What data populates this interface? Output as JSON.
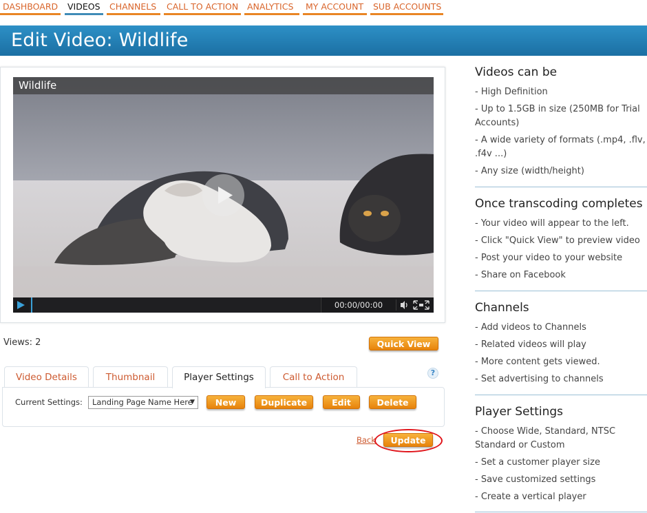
{
  "nav": {
    "items": [
      {
        "label": "DASHBOARD"
      },
      {
        "label": "VIDEOS"
      },
      {
        "label": "CHANNELS"
      },
      {
        "label": "CALL TO ACTION"
      },
      {
        "label": "ANALYTICS"
      },
      {
        "label": "MY ACCOUNT"
      },
      {
        "label": "SUB ACCOUNTS"
      }
    ],
    "active": "VIDEOS"
  },
  "header": {
    "title": "Edit Video: Wildlife"
  },
  "player": {
    "title": "Wildlife",
    "time": "00:00/00:00",
    "progress_fraction": 0.0
  },
  "views": {
    "text": "Views: 2"
  },
  "quick_view": {
    "label": "Quick View"
  },
  "tabs": {
    "items": [
      {
        "label": "Video Details"
      },
      {
        "label": "Thumbnail"
      },
      {
        "label": "Player Settings"
      },
      {
        "label": "Call to Action"
      }
    ],
    "active": "Player Settings"
  },
  "settings": {
    "label": "Current Settings:",
    "selected": "Landing Page Name Here",
    "buttons": {
      "new": "New",
      "duplicate": "Duplicate",
      "edit": "Edit",
      "delete": "Delete"
    },
    "help": "?"
  },
  "footer": {
    "back": "Back",
    "update": "Update"
  },
  "sidebar": {
    "sections": [
      {
        "heading": "Videos can be",
        "items": [
          "- High Definition",
          "- Up to 1.5GB in size (250MB for Trial Accounts)",
          "- A wide variety of formats (.mp4, .flv, .f4v ...)",
          "- Any size (width/height)"
        ]
      },
      {
        "heading": "Once transcoding completes",
        "items": [
          "- Your video will appear to the left.",
          "- Click \"Quick View\" to preview video",
          "- Post your video to your website",
          "- Share on Facebook"
        ]
      },
      {
        "heading": "Channels",
        "items": [
          "- Add videos to Channels",
          "- Related videos will play",
          "- More content gets viewed.",
          "- Set advertising to channels"
        ]
      },
      {
        "heading": "Player Settings",
        "items": [
          "- Choose Wide, Standard, NTSC Standard or Custom",
          "- Set a customer player size",
          "- Save customized settings",
          "- Create a vertical player"
        ]
      }
    ]
  },
  "colors": {
    "accent_orange": "#e98524",
    "header_blue": "#1f7bb3",
    "link_orange": "#cd5a30",
    "highlight_red": "#e0141a"
  }
}
